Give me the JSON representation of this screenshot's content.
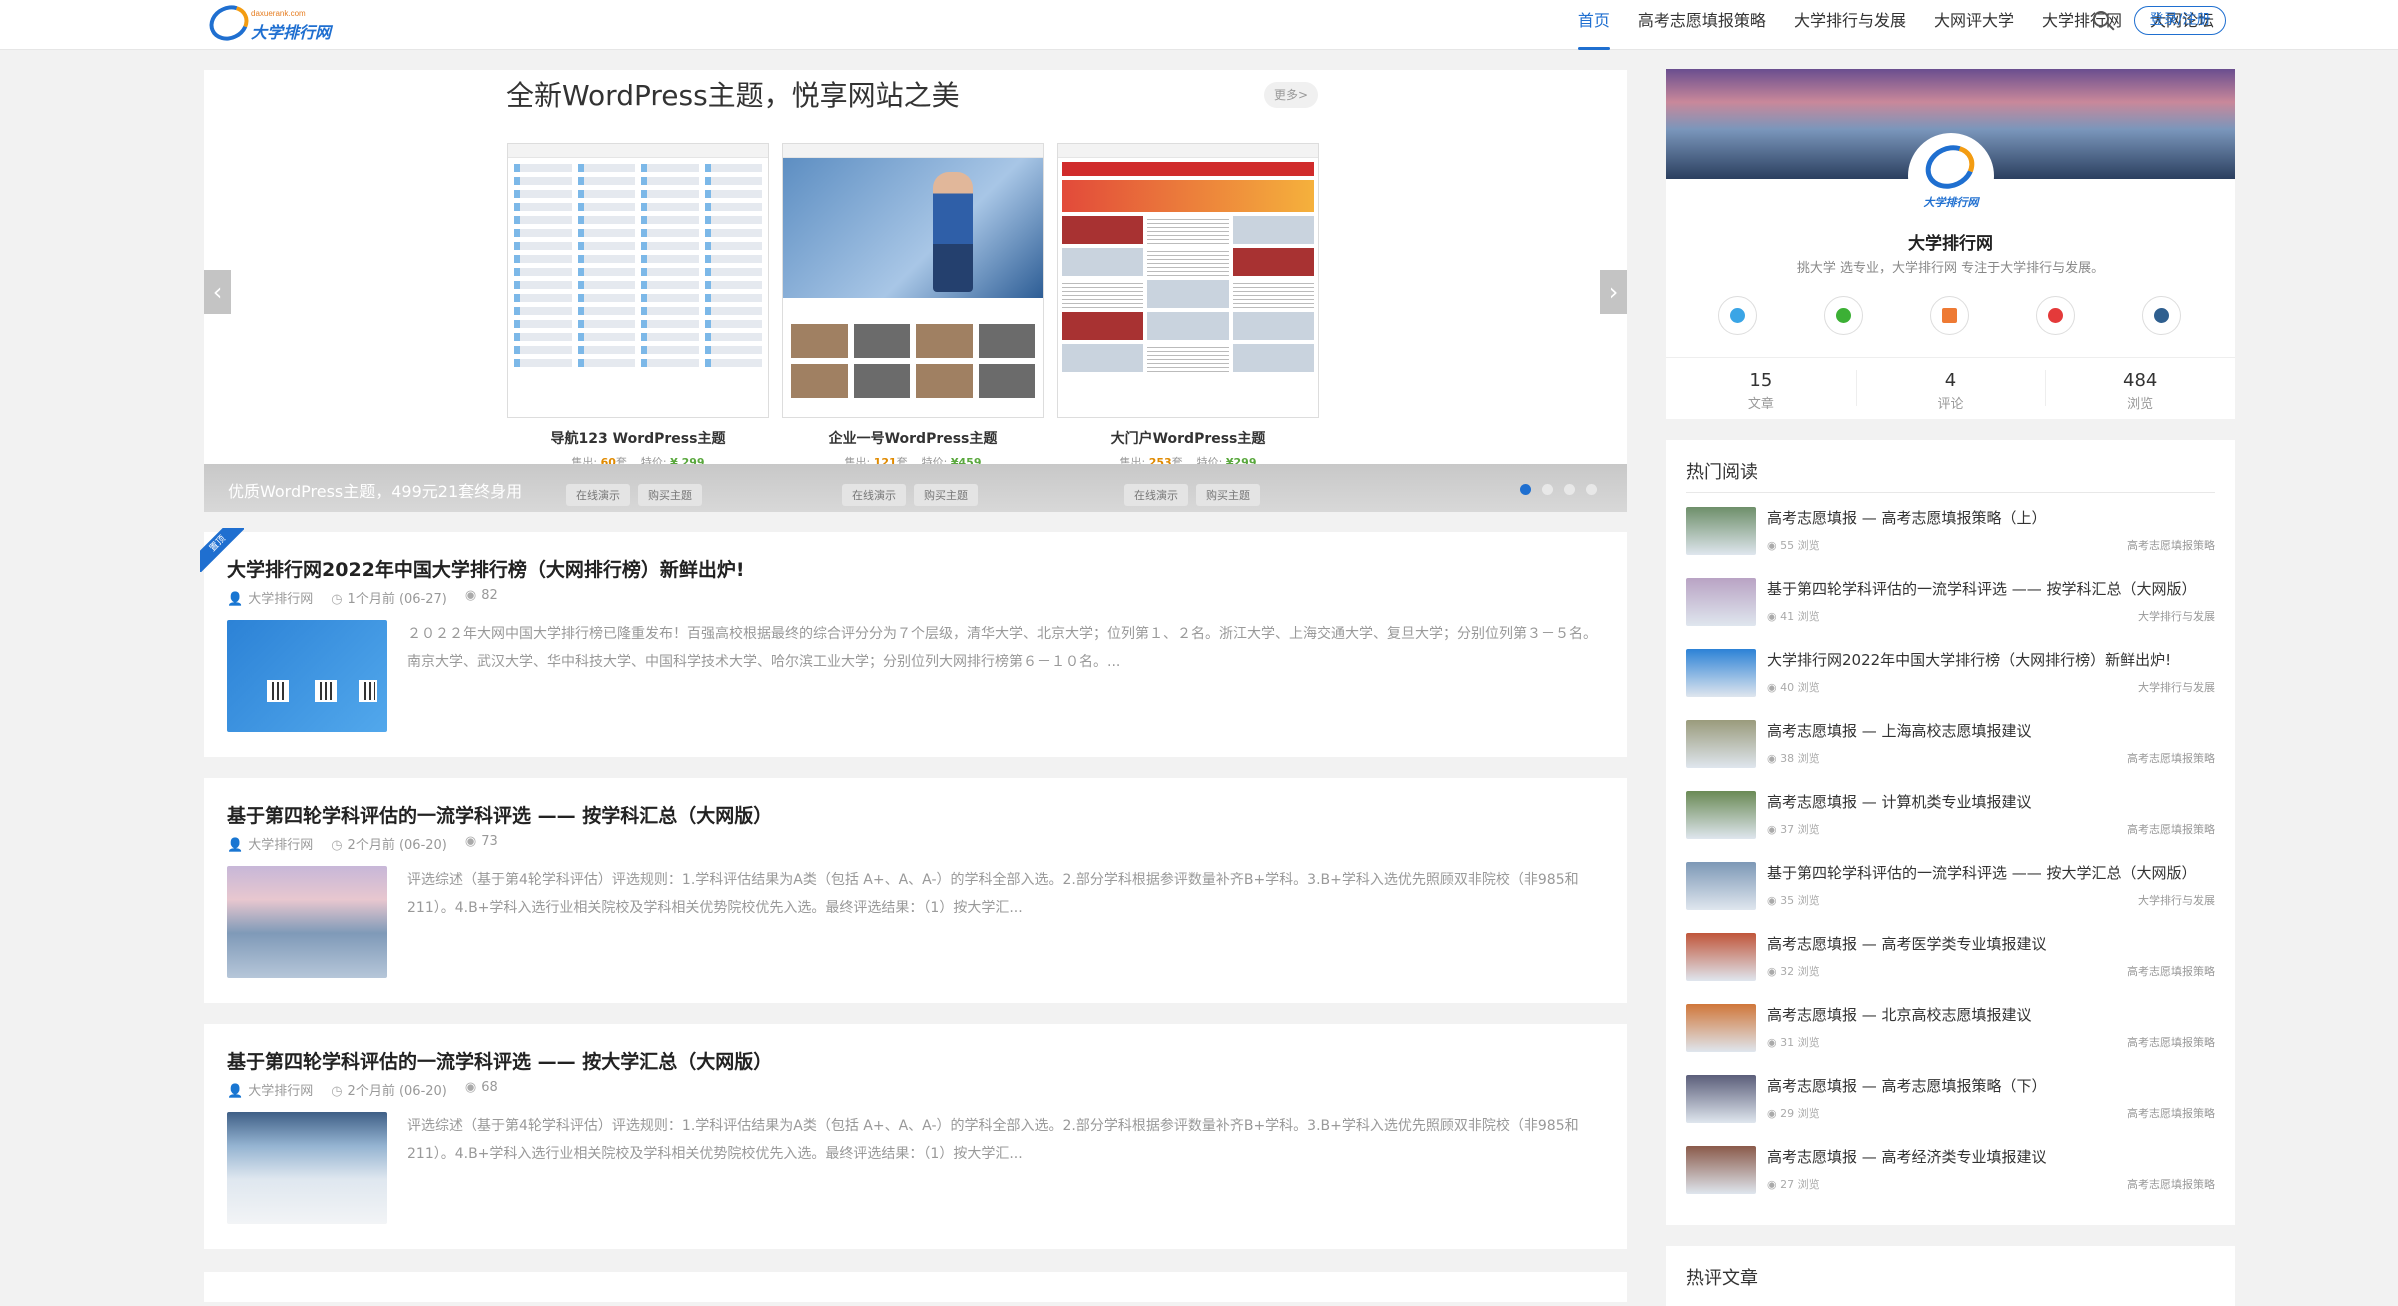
{
  "header": {
    "logo_small": "daxuerank.com",
    "logo_text": "大学排行网",
    "nav": [
      "首页",
      "高考志愿填报策略",
      "大学排行与发展",
      "大网评大学",
      "大学排行网",
      "大网论坛"
    ],
    "login": "登录/注册"
  },
  "slider": {
    "title": "全新WordPress主题，悦享网站之美",
    "more": "更多>",
    "caption": "优质WordPress主题，499元21套终身用",
    "demo_label": "在线演示",
    "buy_label": "购买主题",
    "themes": [
      {
        "name": "导航123 WordPress主题",
        "sold": "售出: ",
        "sold_count": "60",
        "sold_unit": "套",
        "price_label": "特价: ",
        "price": "¥ 299"
      },
      {
        "name": "企业一号WordPress主题",
        "sold": "售出: ",
        "sold_count": "121",
        "sold_unit": "套",
        "price_label": "特价: ",
        "price": "¥459"
      },
      {
        "name": "大门户WordPress主题",
        "sold": "售出: ",
        "sold_count": "253",
        "sold_unit": "套",
        "price_label": "特价: ",
        "price": "¥299"
      }
    ],
    "active_dot": 0
  },
  "posts": [
    {
      "sticky": "置顶",
      "title": "大学排行网2022年中国大学排行榜（大网排行榜）新鲜出炉!",
      "author": "大学排行网",
      "date": "1个月前 (06-27)",
      "views": "82",
      "excerpt": "２０２２年大网中国大学排行榜已隆重发布！百强高校根据最终的综合评分分为７个层级，清华大学、北京大学；位列第１、２名。浙江大学、上海交通大学、复旦大学；分别位列第３－５名。南京大学、武汉大学、华中科技大学、中国科学技术大学、哈尔滨工业大学；分别位列大网排行榜第６－１０名。..."
    },
    {
      "title": "基于第四轮学科评估的一流学科评选 —— 按学科汇总（大网版）",
      "author": "大学排行网",
      "date": "2个月前 (06-20)",
      "views": "73",
      "excerpt": "评选综述（基于第4轮学科评估）评选规则：1.学科评估结果为A类（包括 A+、A、A-）的学科全部入选。2.部分学科根据参评数量补齐B+学科。3.B+学科入选优先照顾双非院校（非985和211）。4.B+学科入选行业相关院校及学科相关优势院校优先入选。最终评选结果：（1）按大学汇..."
    },
    {
      "title": "基于第四轮学科评估的一流学科评选 —— 按大学汇总（大网版）",
      "author": "大学排行网",
      "date": "2个月前 (06-20)",
      "views": "68",
      "excerpt": "评选综述（基于第4轮学科评估）评选规则：1.学科评估结果为A类（包括 A+、A、A-）的学科全部入选。2.部分学科根据参评数量补齐B+学科。3.B+学科入选优先照顾双非院校（非985和211）。4.B+学科入选行业相关院校及学科相关优势院校优先入选。最终评选结果：（1）按大学汇..."
    }
  ],
  "profile": {
    "avatar_text": "大学排行网",
    "name": "大学排行网",
    "desc": "挑大学 选专业，大学排行网 专注于大学排行与发展。",
    "stats": [
      {
        "num": "15",
        "label": "文章"
      },
      {
        "num": "4",
        "label": "评论"
      },
      {
        "num": "484",
        "label": "浏览"
      }
    ]
  },
  "hot": {
    "title": "热门阅读",
    "items": [
      {
        "title": "高考志愿填报 — 高考志愿填报策略（上）",
        "views": "55 浏览",
        "cat": "高考志愿填报策略",
        "color": "#6e8f6a"
      },
      {
        "title": "基于第四轮学科评估的一流学科评选 —— 按学科汇总（大网版）",
        "views": "41 浏览",
        "cat": "大学排行与发展",
        "color": "#b9a3c4"
      },
      {
        "title": "大学排行网2022年中国大学排行榜（大网排行榜）新鲜出炉!",
        "views": "40 浏览",
        "cat": "大学排行与发展",
        "color": "#2c82d6"
      },
      {
        "title": "高考志愿填报 — 上海高校志愿填报建议",
        "views": "38 浏览",
        "cat": "高考志愿填报策略",
        "color": "#9a9b7c"
      },
      {
        "title": "高考志愿填报 — 计算机类专业填报建议",
        "views": "37 浏览",
        "cat": "高考志愿填报策略",
        "color": "#6a8a55"
      },
      {
        "title": "基于第四轮学科评估的一流学科评选 —— 按大学汇总（大网版）",
        "views": "35 浏览",
        "cat": "大学排行与发展",
        "color": "#7d98b6"
      },
      {
        "title": "高考志愿填报 — 高考医学类专业填报建议",
        "views": "32 浏览",
        "cat": "高考志愿填报策略",
        "color": "#c0563a"
      },
      {
        "title": "高考志愿填报 — 北京高校志愿填报建议",
        "views": "31 浏览",
        "cat": "高考志愿填报策略",
        "color": "#d0773a"
      },
      {
        "title": "高考志愿填报 — 高考志愿填报策略（下）",
        "views": "29 浏览",
        "cat": "高考志愿填报策略",
        "color": "#5b5e7a"
      },
      {
        "title": "高考志愿填报 — 高考经济类专业填报建议",
        "views": "27 浏览",
        "cat": "高考志愿填报策略",
        "color": "#8a5a4a"
      }
    ]
  },
  "hot_comments": {
    "title": "热评文章"
  }
}
